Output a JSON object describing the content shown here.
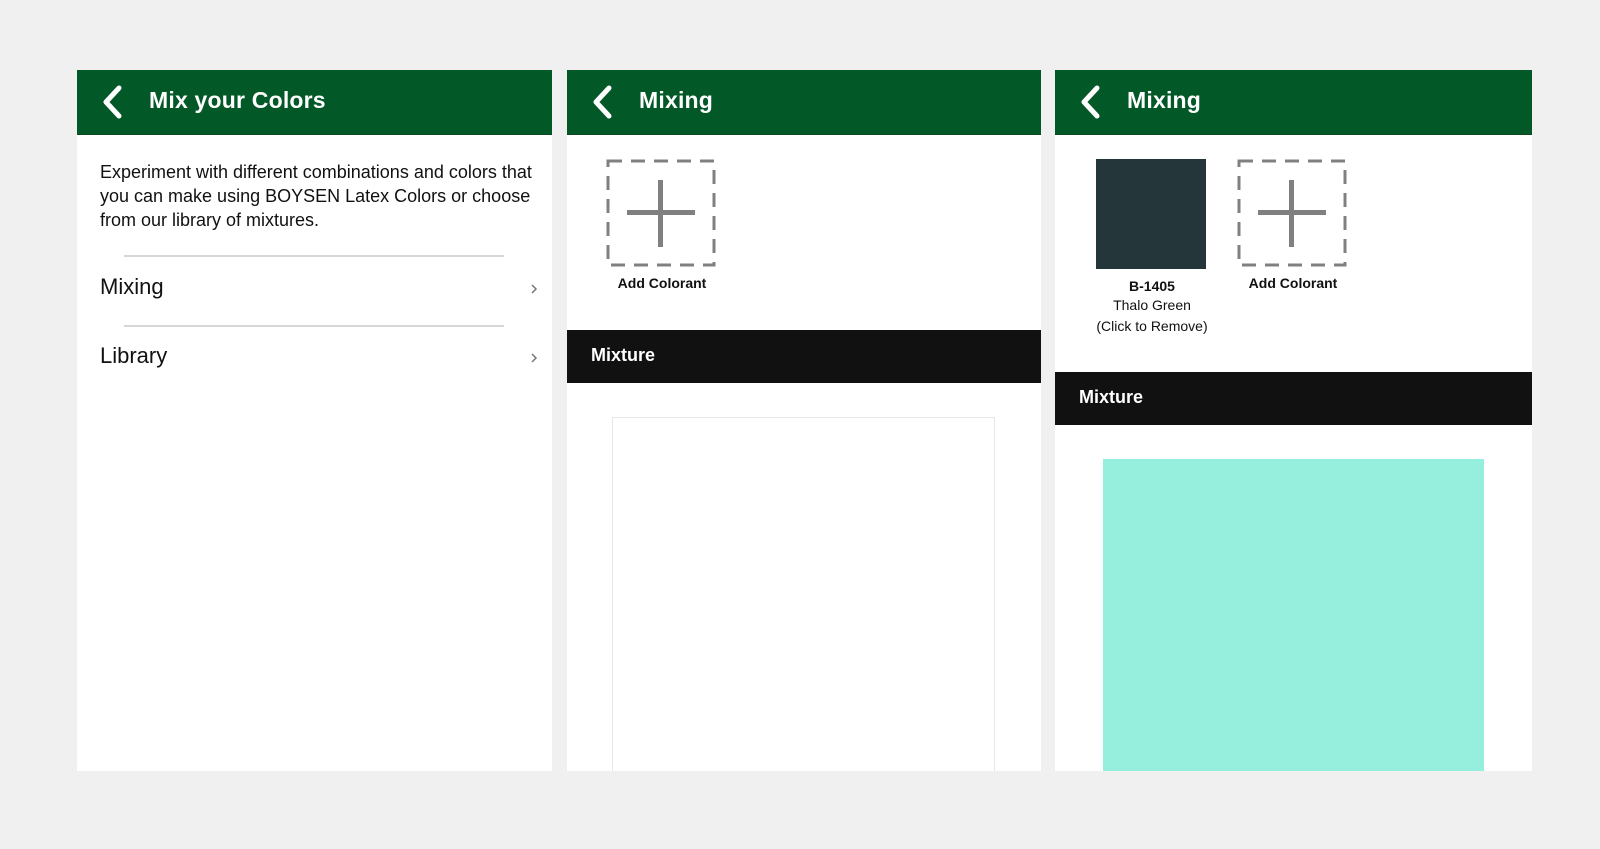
{
  "colors": {
    "header_bg": "#025826",
    "mixture_bar_bg": "#111111",
    "page_bg": "#f0f0f0"
  },
  "screens": [
    {
      "header": {
        "back_icon": "chevron-left-icon",
        "title": "Mix your Colors"
      },
      "intro_text": "Experiment with different combinations and colors that you can make using BOYSEN Latex Colors or choose from our library of mixtures.",
      "menu": [
        {
          "label": "Mixing",
          "icon": "chevron-right-icon"
        },
        {
          "label": "Library",
          "icon": "chevron-right-icon"
        }
      ]
    },
    {
      "header": {
        "back_icon": "chevron-left-icon",
        "title": "Mixing"
      },
      "colorants": [],
      "add_colorant_label": "Add Colorant",
      "mixture_label": "Mixture",
      "mixture_color": "#ffffff"
    },
    {
      "header": {
        "back_icon": "chevron-left-icon",
        "title": "Mixing"
      },
      "colorants": [
        {
          "code": "B-1405",
          "name": "Thalo Green",
          "hint": "(Click to Remove)",
          "color": "#25363a"
        }
      ],
      "add_colorant_label": "Add Colorant",
      "mixture_label": "Mixture",
      "mixture_color": "#95efdc"
    }
  ]
}
